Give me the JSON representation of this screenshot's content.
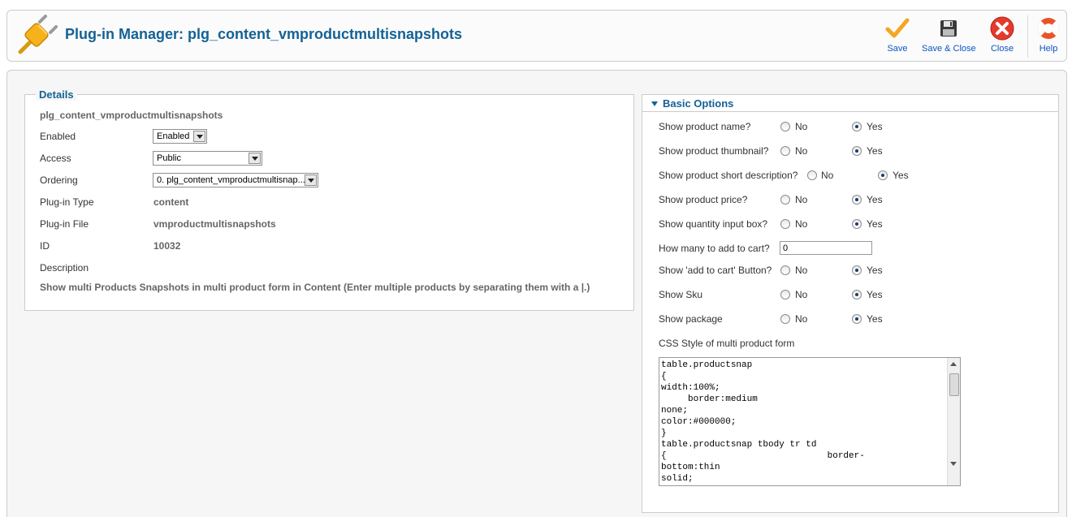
{
  "toolbar": {
    "title": "Plug-in Manager: plg_content_vmproductmultisnapshots",
    "page_icon": "plugin-icon",
    "buttons": {
      "save": "Save",
      "save_close": "Save & Close",
      "close": "Close",
      "help": "Help"
    }
  },
  "details": {
    "legend": "Details",
    "plugin_name": "plg_content_vmproductmultisnapshots",
    "enabled_label": "Enabled",
    "enabled_value": "Enabled",
    "access_label": "Access",
    "access_value": "Public",
    "ordering_label": "Ordering",
    "ordering_value": "0. plg_content_vmproductmultisnap...",
    "type_label": "Plug-in Type",
    "type_value": "content",
    "file_label": "Plug-in File",
    "file_value": "vmproductmultisnapshots",
    "id_label": "ID",
    "id_value": "10032",
    "description_label": "Description",
    "description_value": "Show multi Products  Snapshots in multi product form in Content (Enter multiple products by separating them with a |.)"
  },
  "options": {
    "header": "Basic Options",
    "no_label": "No",
    "yes_label": "Yes",
    "rows": [
      {
        "label": "Show product name?",
        "value": "Yes"
      },
      {
        "label": "Show product thumbnail?",
        "value": "Yes"
      },
      {
        "label": "Show product short description?",
        "value": "Yes"
      },
      {
        "label": "Show product price?",
        "value": "Yes"
      },
      {
        "label": "Show quantity input box?",
        "value": "Yes"
      }
    ],
    "add_to_cart_label": "How many to add to cart?",
    "add_to_cart_value": "0",
    "rows2": [
      {
        "label": "Show 'add to cart' Button?",
        "value": "Yes"
      },
      {
        "label": "Show Sku",
        "value": "Yes"
      },
      {
        "label": "Show package",
        "value": "Yes"
      }
    ],
    "css_label": "CSS Style of multi product form",
    "css_value": "table.productsnap\n{\nwidth:100%;\n     border:medium\nnone;\ncolor:#000000;\n}\ntable.productsnap tbody tr td\n{                              border-\nbottom:thin\nsolid;"
  },
  "colors": {
    "title_blue": "#146295",
    "link_blue": "#0b55c4",
    "save_orange": "#f5a623",
    "close_red": "#e53a2b"
  }
}
